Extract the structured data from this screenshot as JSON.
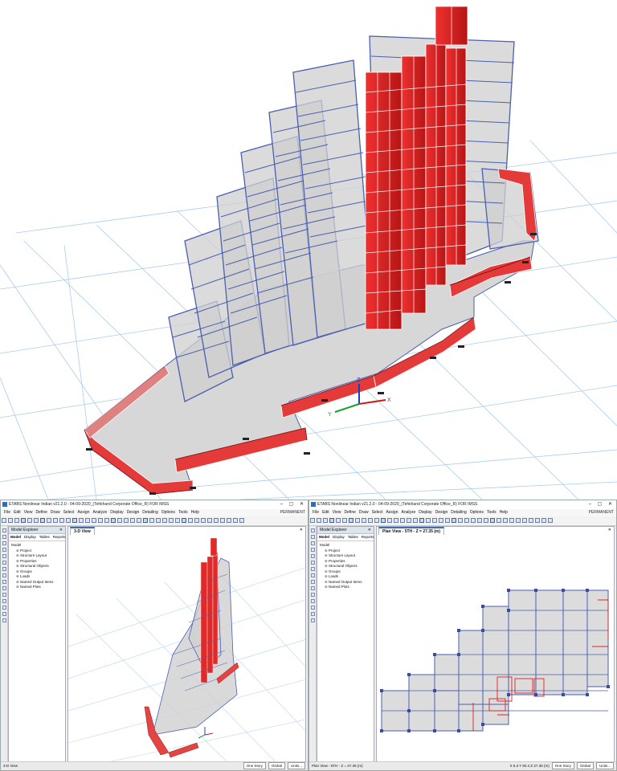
{
  "window": {
    "title": "ETABS Nonlinear Indian v21.2.0 - 04-09-2020_(Tehkhand Corporate Office_R) FOR IMSS",
    "license": "PERMANENT",
    "menu": [
      "File",
      "Edit",
      "View",
      "Define",
      "Draw",
      "Select",
      "Assign",
      "Analyze",
      "Display",
      "Design",
      "Detailing",
      "Options",
      "Tools",
      "Help"
    ]
  },
  "left_window": {
    "explorer_title": "Model Explorer",
    "tabs": [
      "Model",
      "Display",
      "Tables",
      "Reports"
    ],
    "tree_root": "Model",
    "tree_items": [
      "Project",
      "Structure Layout",
      "Properties",
      "Structural Objects",
      "Groups",
      "Loads",
      "Named Output Items",
      "Named Plots"
    ],
    "view_tab": "3-D View",
    "status_left": "3-D View",
    "status_story": "One Story",
    "status_coord": "Global",
    "status_units": "Units..."
  },
  "right_window": {
    "explorer_title": "Model Explorer",
    "tabs": [
      "Model",
      "Display",
      "Tables",
      "Reports"
    ],
    "tree_root": "Model",
    "tree_items": [
      "Project",
      "Structure Layout",
      "Properties",
      "Structural Objects",
      "Groups",
      "Loads",
      "Named Output Items",
      "Named Plots"
    ],
    "view_tab": "Plan View - 5TH - Z = 27.35 (m)",
    "status_left": "Plan View - 5TH - Z = 27.35 (m)",
    "status_xy": "X 6.3  Y 60.4  Z 27.35 (m)",
    "status_story": "One Story",
    "status_coord": "Global",
    "status_units": "Units..."
  },
  "colors": {
    "frame": "#4a5fb0",
    "core": "#e02020",
    "slab": "#d8d8d8",
    "grid": "#9ec5ea",
    "accent": "#3a6fb8"
  },
  "axes": {
    "x": "X",
    "y": "Y",
    "z": "Z"
  }
}
